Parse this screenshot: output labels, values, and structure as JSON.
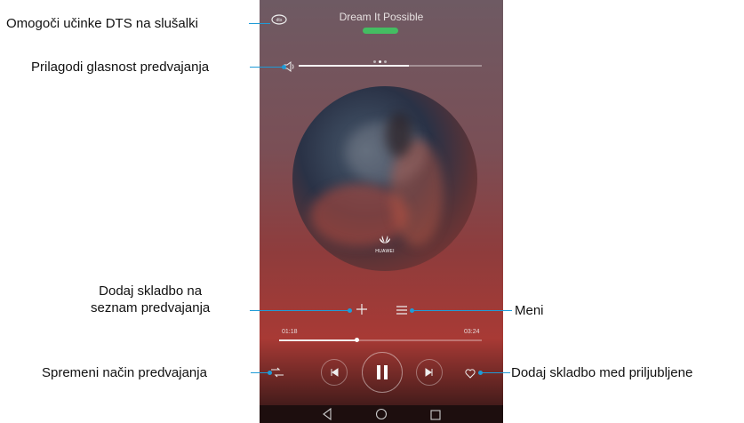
{
  "player": {
    "song_title": "Dream It Possible",
    "time_elapsed": "01:18",
    "time_total": "03:24",
    "volume_level": 0.6,
    "progress_fraction": 0.38,
    "album_brand": "HUAWEI"
  },
  "callouts": {
    "dts": "Omogoči učinke DTS na slušalki",
    "volume": "Prilagodi glasnost predvajanja",
    "add_to_playlist": "Dodaj skladbo na\nseznam predvajanja",
    "menu": "Meni",
    "play_mode": "Spremeni način predvajanja",
    "favorite": "Dodaj skladbo med priljubljene"
  },
  "icons": {
    "dts": "dts-icon",
    "volume": "speaker-icon",
    "add": "plus-icon",
    "menu": "menu-icon",
    "shuffle": "shuffle-icon",
    "prev": "previous-icon",
    "pause": "pause-icon",
    "next": "next-icon",
    "favorite": "heart-icon",
    "back": "back-icon",
    "home": "home-icon",
    "recents": "recents-icon"
  },
  "colors": {
    "callout_line": "#1f9bd7",
    "artist_pill": "#3ccf63"
  }
}
